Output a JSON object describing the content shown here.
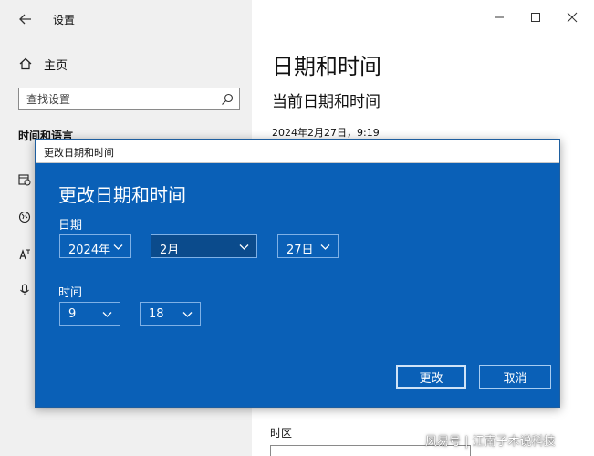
{
  "window": {
    "title": "设置"
  },
  "sidebar": {
    "home_label": "主页",
    "search_placeholder": "查找设置",
    "section_title": "时间和语言",
    "icons": [
      "date-time-icon",
      "region-icon",
      "language-icon",
      "speech-icon"
    ]
  },
  "main": {
    "page_title": "日期和时间",
    "subtitle": "当前日期和时间",
    "current_datetime": "2024年2月27日，9:19",
    "timezone_label": "时区"
  },
  "dialog": {
    "window_title": "更改日期和时间",
    "heading": "更改日期和时间",
    "date_label": "日期",
    "year": "2024年",
    "month": "2月",
    "day": "27日",
    "time_label": "时间",
    "hour": "9",
    "minute": "18",
    "change_button": "更改",
    "cancel_button": "取消"
  },
  "watermark": "风易号 | 江南子木说科技",
  "colors": {
    "dialog_blue": "#0a60b7",
    "selected_combo": "#0b4b8c",
    "sidebar_bg": "#f0f0f0"
  }
}
